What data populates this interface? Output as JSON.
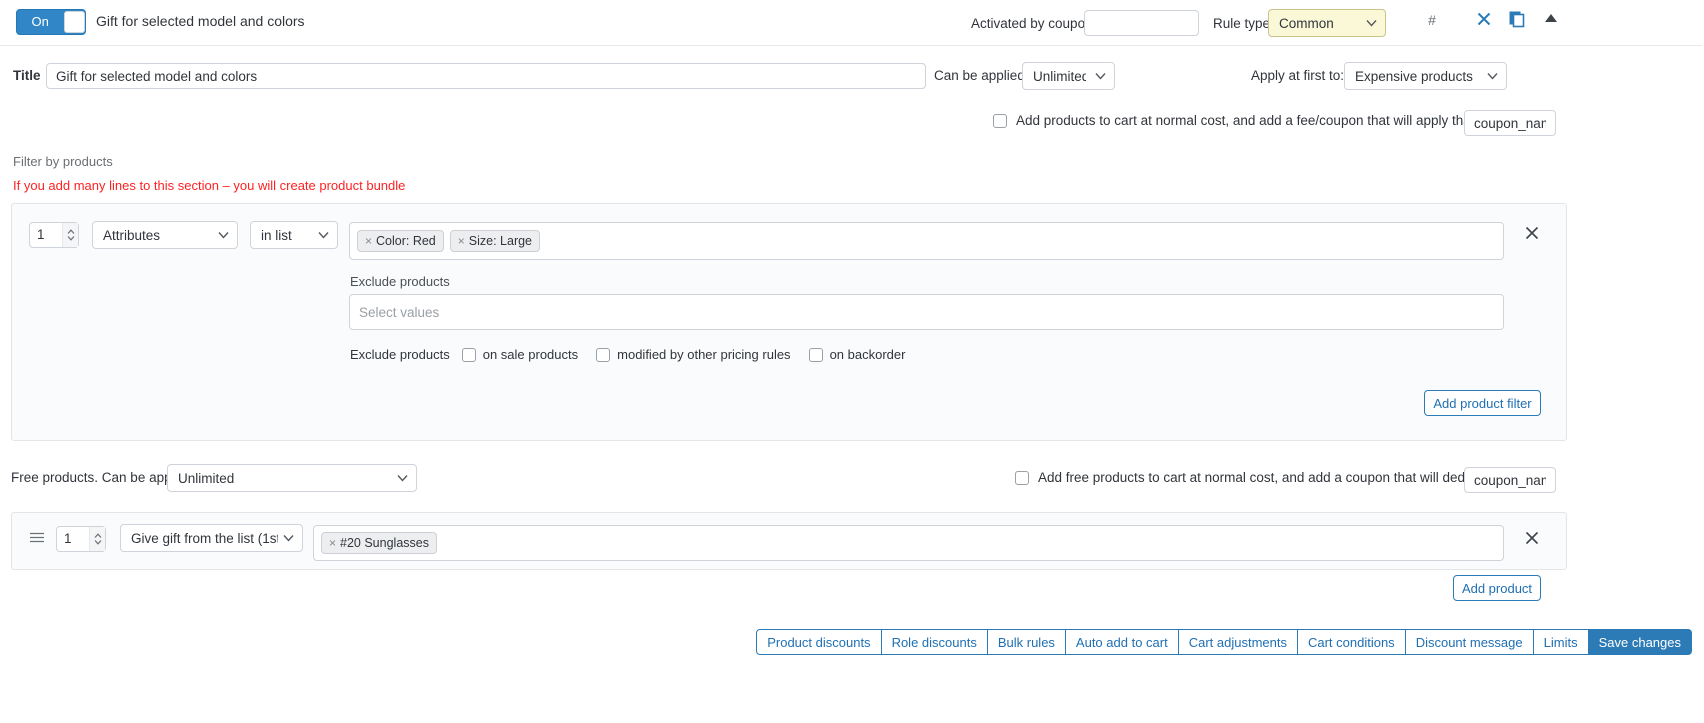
{
  "header": {
    "toggle_label": "On",
    "title": "Gift for selected model and colors",
    "activated_by_coupon_label": "Activated by coupon",
    "activated_by_coupon_value": "",
    "rule_type_label": "Rule type",
    "rule_type_value": "Common",
    "rule_type_options": [
      "Common"
    ],
    "hash_icon": "hash-icon",
    "close_icon": "close-icon",
    "copy_icon": "copy-icon",
    "collapse_icon": "collapse-up-icon",
    "accent_color": "#3186c8",
    "rule_type_bg": "#fbf8d8"
  },
  "title_row": {
    "label": "Title",
    "value": "Gift for selected model and colors",
    "can_be_applied_label": "Can be applied",
    "can_be_applied_value": "Unlimited",
    "can_be_applied_options": [
      "Unlimited"
    ],
    "apply_at_first_label": "Apply at first to:",
    "apply_at_first_value": "Expensive products",
    "apply_at_first_options": [
      "Expensive products"
    ]
  },
  "normal_cost": {
    "checked": false,
    "label": "Add products to cart at normal cost, and add a fee/coupon that will apply that cost",
    "coupon_input_value": "coupon_nam"
  },
  "filter_section": {
    "label": "Filter by products",
    "warning": "If you add many lines to this section – you will create product bundle",
    "warning_color": "#ff2222",
    "row": {
      "quantity": "1",
      "source_value": "Attributes",
      "source_options": [
        "Attributes"
      ],
      "condition_value": "in list",
      "condition_options": [
        "in list"
      ],
      "tags": [
        {
          "x": "×",
          "label": "Color: Red"
        },
        {
          "x": "×",
          "label": "Size: Large"
        }
      ],
      "remove_icon": "close-icon"
    },
    "exclude_label": "Exclude products",
    "exclude_placeholder": "Select values",
    "exclude_row_lead": "Exclude products",
    "exclude_options": [
      {
        "label": "on sale products",
        "checked": false
      },
      {
        "label": "modified by other pricing rules",
        "checked": false
      },
      {
        "label": "on backorder",
        "checked": false
      }
    ],
    "add_filter_button": "Add product filter"
  },
  "free_products": {
    "label": "Free products. Can be applied",
    "applied_value": "Unlimited",
    "applied_options": [
      "Unlimited"
    ],
    "normal_cost_checked": false,
    "normal_cost_label": "Add free products to cart at normal cost, and add a coupon that will deduce that cost",
    "coupon_input_value": "coupon_nam",
    "row": {
      "drag_handle_icon": "drag-handle-icon",
      "quantity": "1",
      "mode_value": "Give gift from the list (1st",
      "mode_options": [
        "Give gift from the list (1st"
      ],
      "tags": [
        {
          "x": "×",
          "label": "#20 Sunglasses"
        }
      ],
      "remove_icon": "close-icon"
    },
    "add_product_button": "Add product"
  },
  "footer": {
    "buttons": [
      {
        "label": "Product discounts",
        "primary": false
      },
      {
        "label": "Role discounts",
        "primary": false
      },
      {
        "label": "Bulk rules",
        "primary": false
      },
      {
        "label": "Auto add to cart",
        "primary": false
      },
      {
        "label": "Cart adjustments",
        "primary": false
      },
      {
        "label": "Cart conditions",
        "primary": false
      },
      {
        "label": "Discount message",
        "primary": false
      },
      {
        "label": "Limits",
        "primary": false
      },
      {
        "label": "Save changes",
        "primary": true
      }
    ]
  }
}
